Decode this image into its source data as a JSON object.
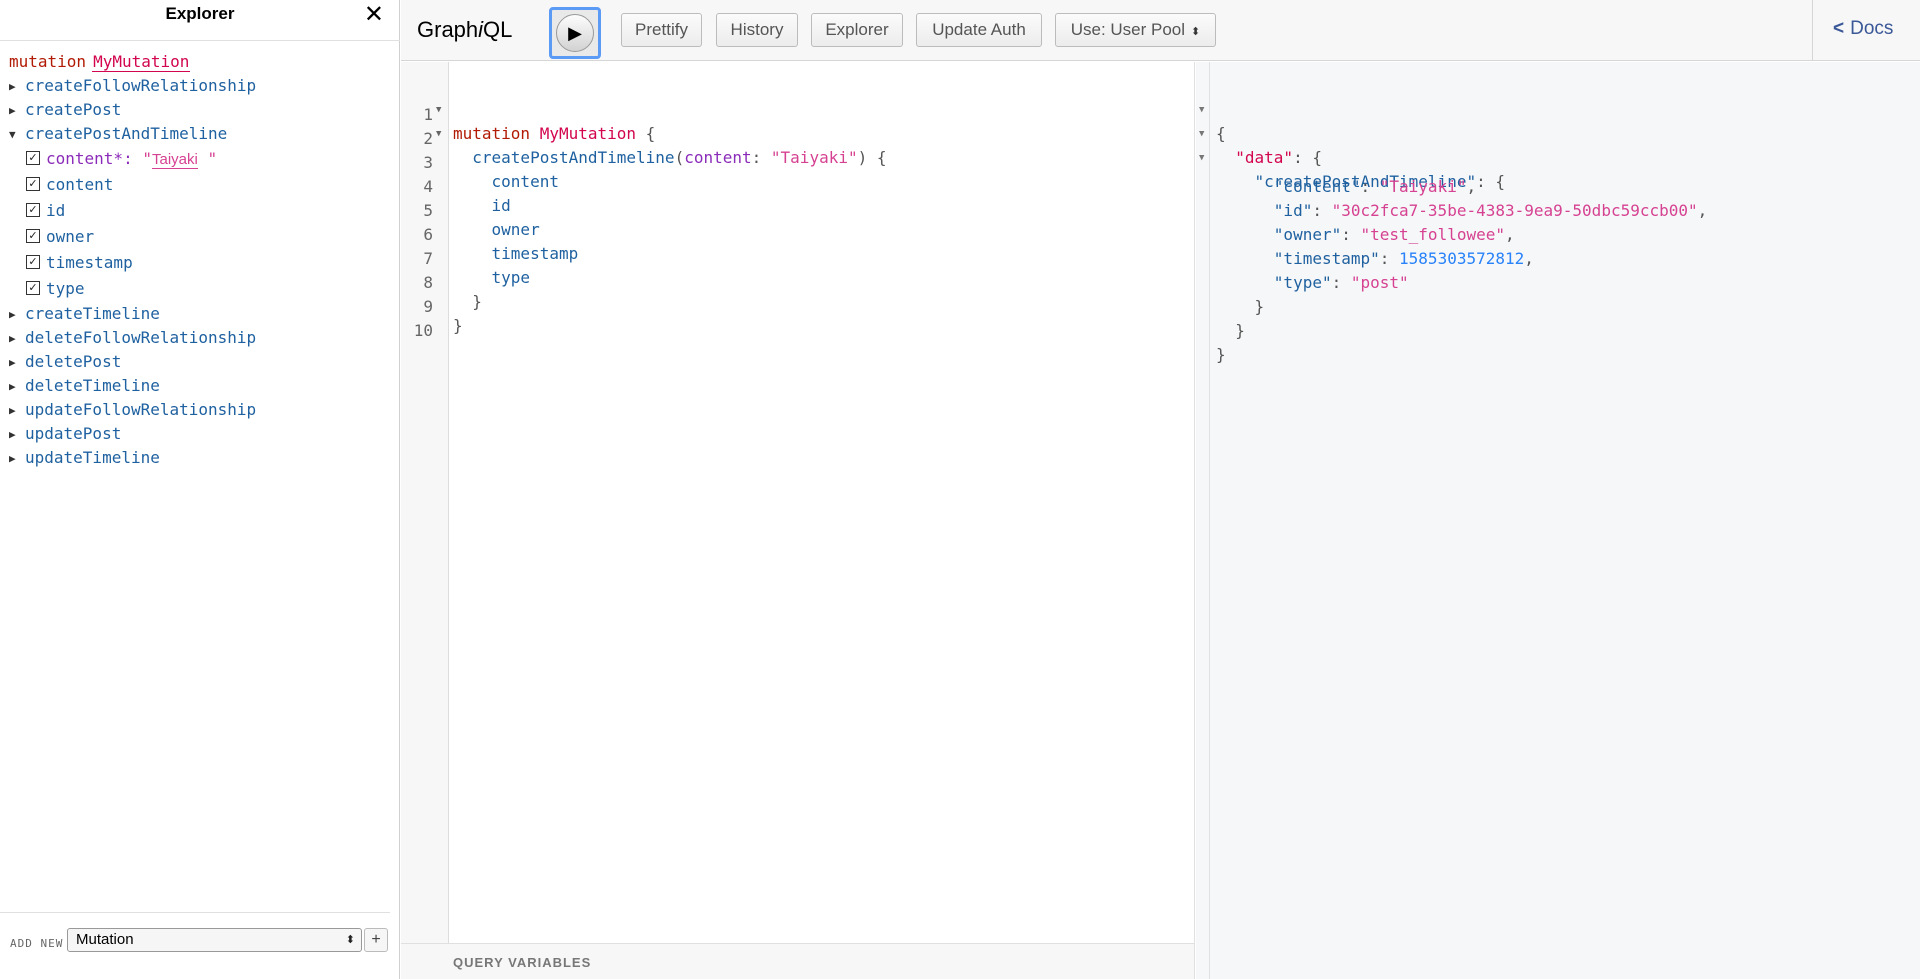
{
  "explorer": {
    "title": "Explorer",
    "close_glyph": "✕",
    "operation": {
      "keyword": "mutation",
      "name": "MyMutation"
    },
    "fields": [
      {
        "name": "createFollowRelationship",
        "expanded": false
      },
      {
        "name": "createPost",
        "expanded": false
      },
      {
        "name": "createPostAndTimeline",
        "expanded": true
      },
      {
        "name": "createTimeline",
        "expanded": false
      },
      {
        "name": "deleteFollowRelationship",
        "expanded": false
      },
      {
        "name": "deletePost",
        "expanded": false
      },
      {
        "name": "deleteTimeline",
        "expanded": false
      },
      {
        "name": "updateFollowRelationship",
        "expanded": false
      },
      {
        "name": "updatePost",
        "expanded": false
      },
      {
        "name": "updateTimeline",
        "expanded": false
      }
    ],
    "expanded_children": {
      "argument": {
        "name": "content*:",
        "value": "Taiyaki",
        "quote": "\""
      },
      "subfields": [
        "content",
        "id",
        "owner",
        "timestamp",
        "type"
      ]
    },
    "footer": {
      "add_new_label": "ADD NEW",
      "operation_type": "Mutation",
      "plus_label": "+"
    }
  },
  "toolbar": {
    "logo_prefix": "Graph",
    "logo_italic": "i",
    "logo_suffix": "QL",
    "run_glyph": "▶",
    "buttons": {
      "prettify": "Prettify",
      "history": "History",
      "explorer": "Explorer",
      "update_auth": "Update Auth",
      "auth_mode": "Use: User Pool"
    },
    "docs_label": "Docs"
  },
  "query_editor": {
    "line_numbers": [
      "1",
      "2",
      "3",
      "4",
      "5",
      "6",
      "7",
      "8",
      "9",
      "10"
    ],
    "line1": {
      "kw": "mutation",
      "name": "MyMutation",
      "brace": " {"
    },
    "line2": {
      "field": "createPostAndTimeline",
      "open": "(",
      "arg": "content",
      "colon": ": ",
      "value": "\"Taiyaki\"",
      "close": ") {"
    },
    "subfields": [
      "content",
      "id",
      "owner",
      "timestamp",
      "type"
    ],
    "line8": "}",
    "line9": "}"
  },
  "query_variables_label": "QUERY VARIABLES",
  "result": {
    "open": "{",
    "data_key": "\"data\"",
    "field_key": "\"createPostAndTimeline\"",
    "content_key": "\"content\"",
    "content_value": "\"Taiyaki\"",
    "id_key": "\"id\"",
    "id_value": "\"30c2fca7-35be-4383-9ea9-50dbc59ccb00\"",
    "owner_key": "\"owner\"",
    "owner_value": "\"test_followee\"",
    "timestamp_key": "\"timestamp\"",
    "timestamp_value": "1585303572812",
    "type_key": "\"type\"",
    "type_value": "\"post\"",
    "close": "}"
  }
}
